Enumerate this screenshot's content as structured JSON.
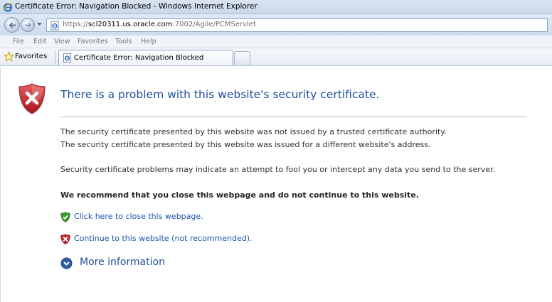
{
  "window": {
    "title": "Certificate Error: Navigation Blocked - Windows Internet Explorer"
  },
  "address_bar": {
    "url_prefix": "https://",
    "url_host": "scl20311.us.oracle.com",
    "url_rest": ":7002/Agile/PCMServlet"
  },
  "menu": {
    "items": [
      "File",
      "Edit",
      "View",
      "Favorites",
      "Tools",
      "Help"
    ]
  },
  "favorites_bar": {
    "favorites_label": "Favorites",
    "tab_label": "Certificate Error: Navigation Blocked"
  },
  "page": {
    "heading": "There is a problem with this website's security certificate.",
    "paragraph1": "The security certificate presented by this website was not issued by a trusted certificate authority.",
    "paragraph2": "The security certificate presented by this website was issued for a different website's address.",
    "paragraph3": "Security certificate problems may indicate an attempt to fool you or intercept any data you send to the server.",
    "recommendation": "We recommend that you close this webpage and do not continue to this website.",
    "close_link": "Click here to close this webpage.",
    "continue_link": "Continue to this website (not recommended).",
    "more_info": "More information"
  },
  "colors": {
    "heading_blue": "#1f4e9a",
    "link_blue": "#1a55a8",
    "shield_red": "#c0272d",
    "safe_green": "#3a9a2f"
  },
  "icons": {
    "title": "ie-icon",
    "back": "back-arrow-icon",
    "forward": "forward-arrow-icon",
    "favorites": "star-icon",
    "warning": "shield-x-icon",
    "close_link": "green-shield-check-icon",
    "continue_link": "red-shield-x-icon",
    "more_info": "chevron-down-circle-icon"
  }
}
